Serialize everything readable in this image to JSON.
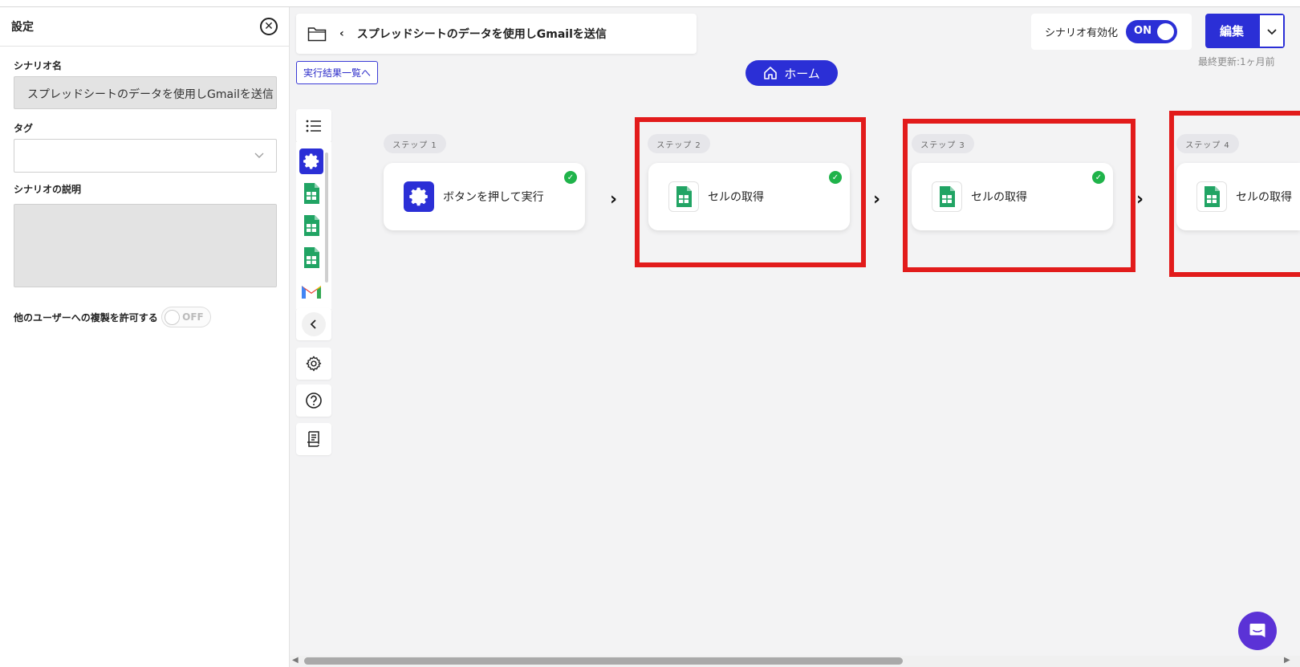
{
  "settings": {
    "title": "設定",
    "scenario_name_label": "シナリオ名",
    "scenario_name_value": "スプレッドシートのデータを使用しGmailを送信",
    "tag_label": "タグ",
    "description_label": "シナリオの説明",
    "copy_permission_label": "他のユーザーへの複製を許可する",
    "copy_permission_state": "OFF"
  },
  "header": {
    "scenario_title": "スプレッドシートのデータを使用しGmailを送信",
    "results_link": "実行結果一覧へ",
    "home_button": "ホーム",
    "enable_label": "シナリオ有効化",
    "enable_state": "ON",
    "edit_button": "編集",
    "last_updated": "最終更新:1ヶ月前"
  },
  "steps": [
    {
      "pill": "ステップ 1",
      "name": "ボタンを押して実行",
      "icon": "gear-icon",
      "done": true
    },
    {
      "pill": "ステップ 2",
      "name": "セルの取得",
      "icon": "google-sheets-icon",
      "done": true
    },
    {
      "pill": "ステップ 3",
      "name": "セルの取得",
      "icon": "google-sheets-icon",
      "done": true
    },
    {
      "pill": "ステップ 4",
      "name": "セルの取得",
      "icon": "google-sheets-icon",
      "done": false
    }
  ],
  "step_list_icons": [
    "gear-icon",
    "google-sheets-icon",
    "google-sheets-icon",
    "google-sheets-icon",
    "gmail-icon"
  ],
  "colors": {
    "accent": "#2b2fd6",
    "highlight": "#e21b1b",
    "success": "#1fb34a",
    "sheets_green": "#21a464"
  }
}
